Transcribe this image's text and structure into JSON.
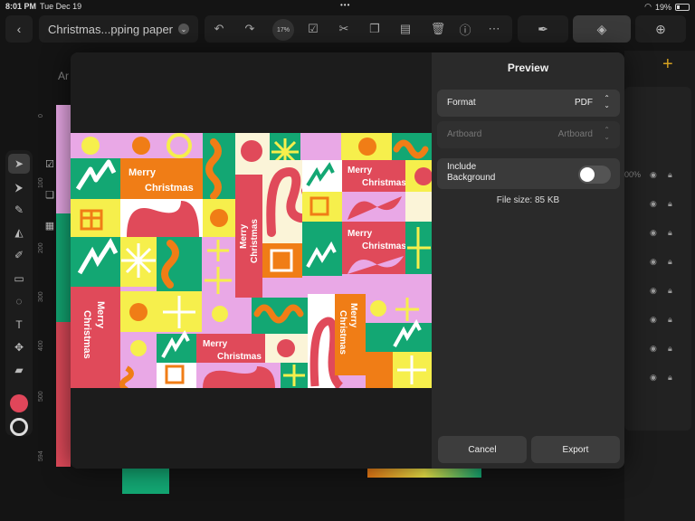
{
  "status": {
    "time": "8:01 PM",
    "date": "Tue Dec 19",
    "battery": "19%",
    "dots": "•••"
  },
  "toolbar": {
    "document_name": "Christmas...pping paper",
    "zoom": "17%"
  },
  "ruler": {
    "top_label": "Ar",
    "marks": [
      "0",
      "100",
      "200",
      "300",
      "400",
      "500",
      "594"
    ]
  },
  "layers": {
    "opacity": "00%"
  },
  "modal": {
    "title": "Preview",
    "format_label": "Format",
    "format_value": "PDF",
    "artboard_label": "Artboard",
    "artboard_value": "Artboard",
    "background_label_1": "Include",
    "background_label_2": "Background",
    "background_on": false,
    "filesize": "File size:  85 KB",
    "cancel_label": "Cancel",
    "export_label": "Export"
  },
  "artwork": {
    "greeting_1": "Merry",
    "greeting_2": "Christmas",
    "colors": {
      "pink": "#e9a8e6",
      "red": "#e04a5a",
      "green": "#13a773",
      "orange": "#f07d16",
      "yellow": "#f6ef4c",
      "cream": "#fbf4d8",
      "white": "#ffffff"
    }
  },
  "icons": [
    "chevron-left-icon",
    "undo-icon",
    "redo-icon",
    "select-box-icon",
    "scissors-icon",
    "copy-icon",
    "paste-icon",
    "trash-icon",
    "help-icon",
    "more-icon",
    "pen-icon",
    "layers-icon",
    "add-icon",
    "arrow-icon",
    "direct-select-icon",
    "pen-tool-icon",
    "node-icon",
    "brush-icon",
    "rectangle-icon",
    "lasso-icon",
    "text-icon",
    "transform-icon",
    "eraser-icon",
    "eye-icon",
    "lock-icon"
  ]
}
